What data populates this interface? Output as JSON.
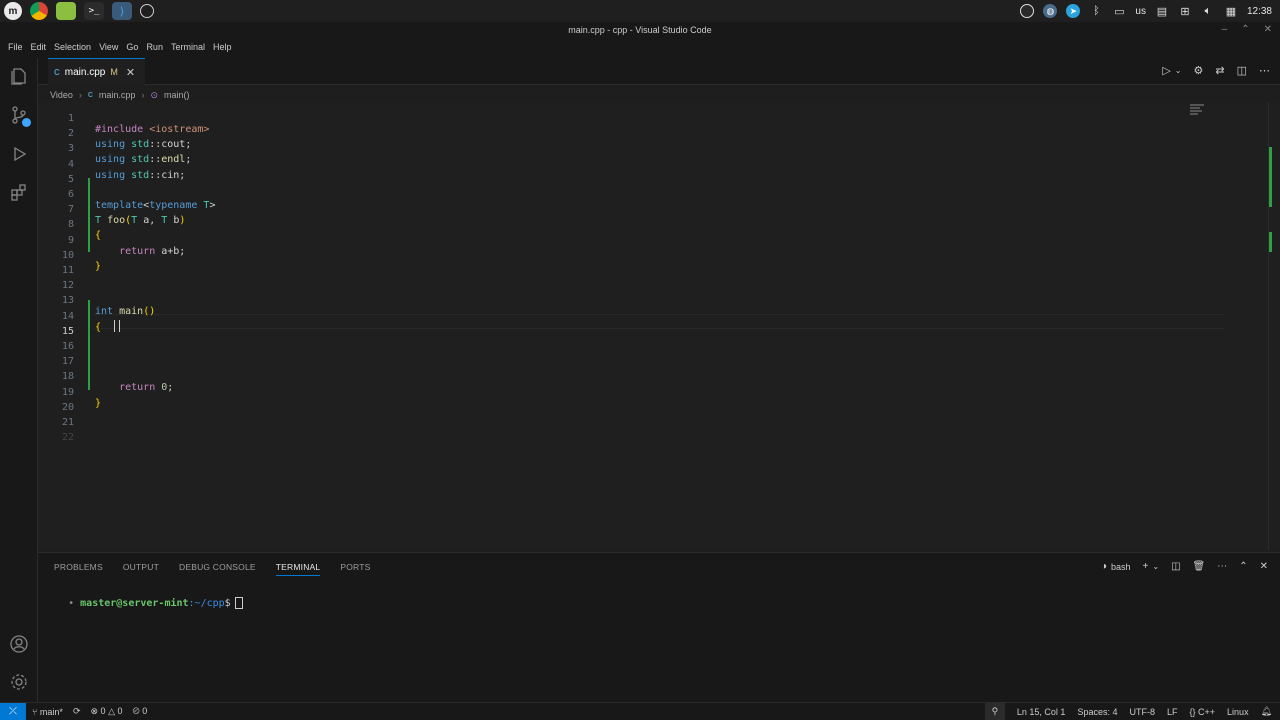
{
  "system_bar": {
    "apps": [
      "mint-menu-icon",
      "chrome-icon",
      "files-icon",
      "terminal-icon",
      "vscode-icon",
      "clock-app-icon"
    ],
    "keyboard_layout": "us",
    "clock": "12:38"
  },
  "window": {
    "title": "main.cpp - cpp - Visual Studio Code"
  },
  "menu": [
    "File",
    "Edit",
    "Selection",
    "View",
    "Go",
    "Run",
    "Terminal",
    "Help"
  ],
  "tab": {
    "label": "main.cpp",
    "modified": "M",
    "icon": "C"
  },
  "breadcrumb": {
    "folder": "Video",
    "file": "main.cpp",
    "symbol": "main()"
  },
  "editor": {
    "lines": [
      "1",
      "2",
      "3",
      "4",
      "5",
      "6",
      "7",
      "8",
      "9",
      "10",
      "11",
      "12",
      "13",
      "14",
      "15",
      "16",
      "17",
      "18",
      "19",
      "20",
      "21",
      "22"
    ],
    "current_line": 15
  },
  "panel": {
    "tabs": [
      "PROBLEMS",
      "OUTPUT",
      "DEBUG CONSOLE",
      "TERMINAL",
      "PORTS"
    ],
    "active_tab": "TERMINAL",
    "shell": "bash",
    "prompt_user": "master@server-mint",
    "prompt_path": ":~/cpp",
    "prompt_symbol": "$"
  },
  "status": {
    "branch": "main*",
    "errors": "0",
    "warnings": "0",
    "ports": "0",
    "position": "Ln 15, Col 1",
    "spaces": "Spaces: 4",
    "encoding": "UTF-8",
    "eol": "LF",
    "language": "C++",
    "os": "Linux"
  },
  "colors": {
    "accent": "#0078d4",
    "git_added": "#2ea043",
    "background": "#1f1f1f"
  }
}
